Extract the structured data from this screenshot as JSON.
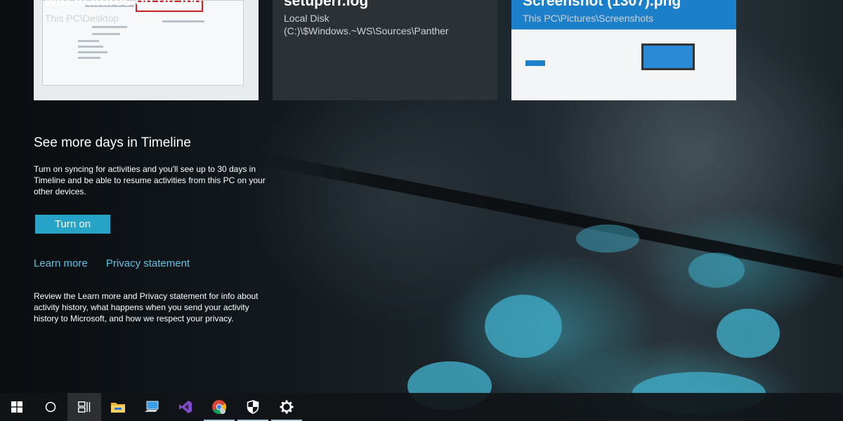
{
  "timeline_cards": [
    {
      "title": "win features on off.jpg",
      "path": "This PC\\Desktop",
      "thumbnail_icon": "image-thumbnail-icon"
    },
    {
      "title": "setuperr.log",
      "path": "Local Disk (C:)\\$Windows.~WS\\Sources\\Panther",
      "thumbnail_icon": "log-file-icon"
    },
    {
      "title": "Screenshot (1307).png",
      "path": "This PC\\Pictures\\Screenshots",
      "thumbnail_icon": "image-thumbnail-icon"
    }
  ],
  "promo": {
    "heading": "See more days in Timeline",
    "description": "Turn on syncing for activities and you'll see up to 30 days in Timeline and be able to resume activities from this PC on your other devices.",
    "turn_on_label": "Turn on",
    "learn_more_label": "Learn more",
    "privacy_label": "Privacy statement",
    "review_text": "Review the Learn more and Privacy statement for info about activity history, what happens when you send your activity history to Microsoft, and how we respect your privacy."
  },
  "taskbar": {
    "items": [
      {
        "name": "start-button",
        "icon": "windows-logo-icon",
        "state": "normal"
      },
      {
        "name": "cortana-button",
        "icon": "circle-icon",
        "state": "normal"
      },
      {
        "name": "task-view-button",
        "icon": "task-view-icon",
        "state": "active"
      },
      {
        "name": "file-explorer-button",
        "icon": "folder-icon",
        "state": "normal"
      },
      {
        "name": "this-pc-button",
        "icon": "computer-icon",
        "state": "normal"
      },
      {
        "name": "visual-studio-button",
        "icon": "visual-studio-icon",
        "state": "normal"
      },
      {
        "name": "chrome-button",
        "icon": "chrome-icon",
        "state": "running"
      },
      {
        "name": "defender-button",
        "icon": "shield-icon",
        "state": "running"
      },
      {
        "name": "settings-button",
        "icon": "gear-icon",
        "state": "running"
      }
    ]
  },
  "colors": {
    "accent": "#26a3c6",
    "link": "#5ec4e6",
    "taskbar": "#101417"
  }
}
